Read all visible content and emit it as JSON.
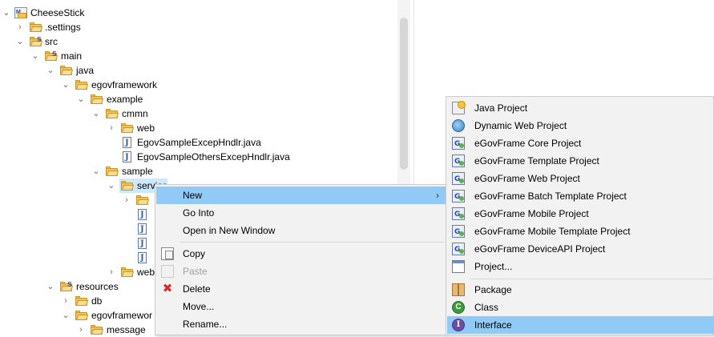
{
  "tree": {
    "project": "CheeseStick",
    "settings": ".settings",
    "src": "src",
    "main": "main",
    "java": "java",
    "egovframework": "egovframework",
    "example": "example",
    "cmmn": "cmmn",
    "web": "web",
    "file1": "EgovSampleExcepHndlr.java",
    "file2": "EgovSampleOthersExcepHndlr.java",
    "sample": "sample",
    "service": "service",
    "sample_web": "web",
    "resources": "resources",
    "db": "db",
    "res_egovframework": "egovframewor",
    "message": "message"
  },
  "context_menu": {
    "items": [
      {
        "label": "New",
        "icon": "none",
        "has_submenu": true,
        "highlighted": true
      },
      {
        "label": "Go Into",
        "icon": "none"
      },
      {
        "label": "Open in New Window",
        "icon": "none"
      },
      {
        "label": "Copy",
        "icon": "copy-icon"
      },
      {
        "label": "Paste",
        "icon": "paste-icon",
        "disabled": true
      },
      {
        "label": "Delete",
        "icon": "delete-icon"
      },
      {
        "label": "Move...",
        "icon": "none"
      },
      {
        "label": "Rename...",
        "icon": "none"
      }
    ]
  },
  "new_submenu": {
    "items": [
      {
        "label": "Java Project",
        "icon": "java-project-icon"
      },
      {
        "label": "Dynamic Web Project",
        "icon": "dynamic-web-project-icon"
      },
      {
        "label": "eGovFrame Core Project",
        "icon": "egovframe-core-project-icon"
      },
      {
        "label": "eGovFrame Template Project",
        "icon": "egovframe-template-project-icon"
      },
      {
        "label": "eGovFrame Web Project",
        "icon": "egovframe-web-project-icon"
      },
      {
        "label": "eGovFrame Batch Template Project",
        "icon": "egovframe-batch-template-project-icon"
      },
      {
        "label": "eGovFrame Mobile Project",
        "icon": "egovframe-mobile-project-icon"
      },
      {
        "label": "eGovFrame Mobile Template Project",
        "icon": "egovframe-mobile-template-project-icon"
      },
      {
        "label": "eGovFrame DeviceAPI Project",
        "icon": "egovframe-deviceapi-project-icon"
      },
      {
        "label": "Project...",
        "icon": "project-icon"
      },
      {
        "label": "Package",
        "icon": "package-icon"
      },
      {
        "label": "Class",
        "icon": "class-icon"
      },
      {
        "label": "Interface",
        "icon": "interface-icon",
        "highlighted": true
      }
    ]
  },
  "colors": {
    "menu_bg": "#f2f2f2",
    "menu_highlight": "#91c9f7",
    "tree_selection": "#cce8ff"
  }
}
